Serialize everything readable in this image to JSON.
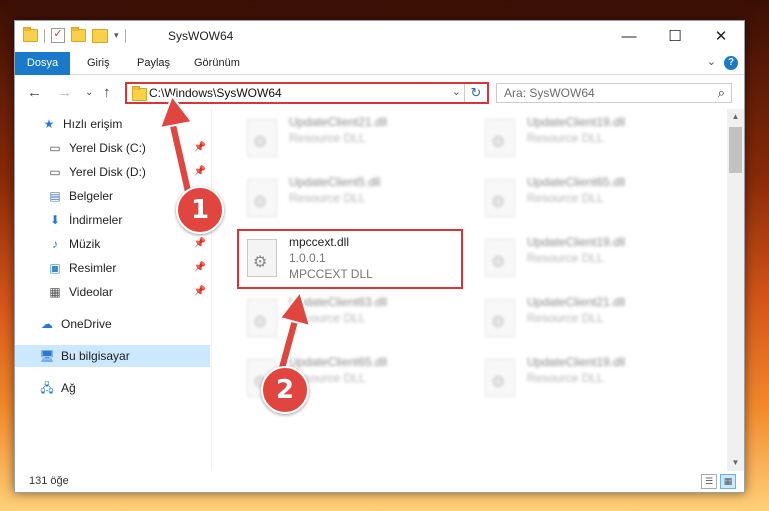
{
  "window": {
    "title": "SysWOW64",
    "controls": {
      "minimize": "—",
      "maximize": "☐",
      "close": "✕"
    }
  },
  "ribbon": {
    "tabs": [
      "Dosya",
      "Giriş",
      "Paylaş",
      "Görünüm"
    ],
    "help": "?",
    "expand": "⌄"
  },
  "nav": {
    "back": "←",
    "forward": "→",
    "recent": "⌄",
    "up": "↑",
    "address": "C:\\Windows\\SysWOW64",
    "refresh": "↻",
    "search_placeholder": "Ara: SysWOW64"
  },
  "sidebar": {
    "items": [
      {
        "label": "Hızlı erişim",
        "icon": "star-icon"
      },
      {
        "label": "Yerel Disk (C:)",
        "icon": "drive-icon"
      },
      {
        "label": "Yerel Disk (D:)",
        "icon": "drive-icon"
      },
      {
        "label": "Belgeler",
        "icon": "documents-icon"
      },
      {
        "label": "İndirmeler",
        "icon": "download-icon"
      },
      {
        "label": "Müzik",
        "icon": "music-icon"
      },
      {
        "label": "Resimler",
        "icon": "pictures-icon"
      },
      {
        "label": "Videolar",
        "icon": "video-icon"
      },
      {
        "label": "OneDrive",
        "icon": "cloud-icon"
      },
      {
        "label": "Bu bilgisayar",
        "icon": "computer-icon"
      },
      {
        "label": "Ağ",
        "icon": "network-icon"
      }
    ],
    "pin_icon": "pin-icon"
  },
  "files": {
    "items": [
      {
        "name": "UpdateClient21.dll",
        "line2": "Resource DLL",
        "line3": ""
      },
      {
        "name": "UpdateClient19.dll",
        "line2": "Resource DLL",
        "line3": ""
      },
      {
        "name": "UpdateClient5.dll",
        "line2": "Resource DLL",
        "line3": ""
      },
      {
        "name": "UpdateClient65.dll",
        "line2": "Resource DLL",
        "line3": ""
      },
      {
        "name": "mpccext.dll",
        "line2": "1.0.0.1",
        "line3": "MPCCEXT DLL"
      },
      {
        "name": "UpdateClient19.dll",
        "line2": "Resource DLL",
        "line3": ""
      },
      {
        "name": "UpdateClient63.dll",
        "line2": "Resource DLL",
        "line3": ""
      },
      {
        "name": "UpdateClient21.dll",
        "line2": "Resource DLL",
        "line3": ""
      },
      {
        "name": "UpdateClient65.dll",
        "line2": "Resource DLL",
        "line3": ""
      },
      {
        "name": "UpdateClient19.dll",
        "line2": "Resource DLL",
        "line3": ""
      }
    ]
  },
  "status": {
    "count": "131 öğe"
  },
  "annotations": {
    "step1": "1",
    "step2": "2",
    "color": "#e0453f"
  }
}
